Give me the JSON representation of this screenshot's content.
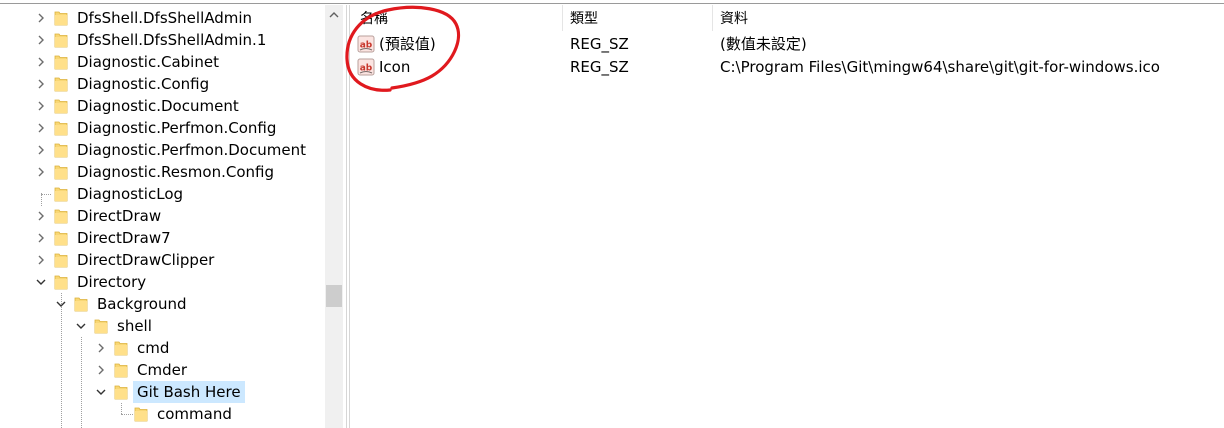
{
  "tree": {
    "items": [
      {
        "label": "DfsShell.DfsShellAdmin",
        "expander": "collapsed"
      },
      {
        "label": "DfsShell.DfsShellAdmin.1",
        "expander": "collapsed"
      },
      {
        "label": "Diagnostic.Cabinet",
        "expander": "collapsed"
      },
      {
        "label": "Diagnostic.Config",
        "expander": "collapsed"
      },
      {
        "label": "Diagnostic.Document",
        "expander": "collapsed"
      },
      {
        "label": "Diagnostic.Perfmon.Config",
        "expander": "collapsed"
      },
      {
        "label": "Diagnostic.Perfmon.Document",
        "expander": "collapsed"
      },
      {
        "label": "Diagnostic.Resmon.Config",
        "expander": "collapsed"
      },
      {
        "label": "DiagnosticLog",
        "expander": "none"
      },
      {
        "label": "DirectDraw",
        "expander": "collapsed"
      },
      {
        "label": "DirectDraw7",
        "expander": "collapsed"
      },
      {
        "label": "DirectDrawClipper",
        "expander": "collapsed"
      },
      {
        "label": "Directory",
        "expander": "expanded"
      },
      {
        "label": "Background",
        "expander": "expanded"
      },
      {
        "label": "shell",
        "expander": "expanded"
      },
      {
        "label": "cmd",
        "expander": "collapsed"
      },
      {
        "label": "Cmder",
        "expander": "collapsed"
      },
      {
        "label": "Git Bash Here",
        "expander": "expanded",
        "selected": true
      },
      {
        "label": "command",
        "expander": "none"
      }
    ]
  },
  "list": {
    "columns": {
      "name": "名稱",
      "type": "類型",
      "data": "資料"
    },
    "rows": [
      {
        "name": "(預設值)",
        "type": "REG_SZ",
        "data": "(數值未設定)",
        "icon": "string-value-icon"
      },
      {
        "name": "Icon",
        "type": "REG_SZ",
        "data": "C:\\Program Files\\Git\\mingw64\\share\\git\\git-for-windows.ico",
        "icon": "string-value-icon"
      }
    ]
  },
  "colors": {
    "selection": "#cce8ff",
    "folder": "#f8d775",
    "annotation": "#e0191e",
    "ab_icon": "#c8362c"
  }
}
